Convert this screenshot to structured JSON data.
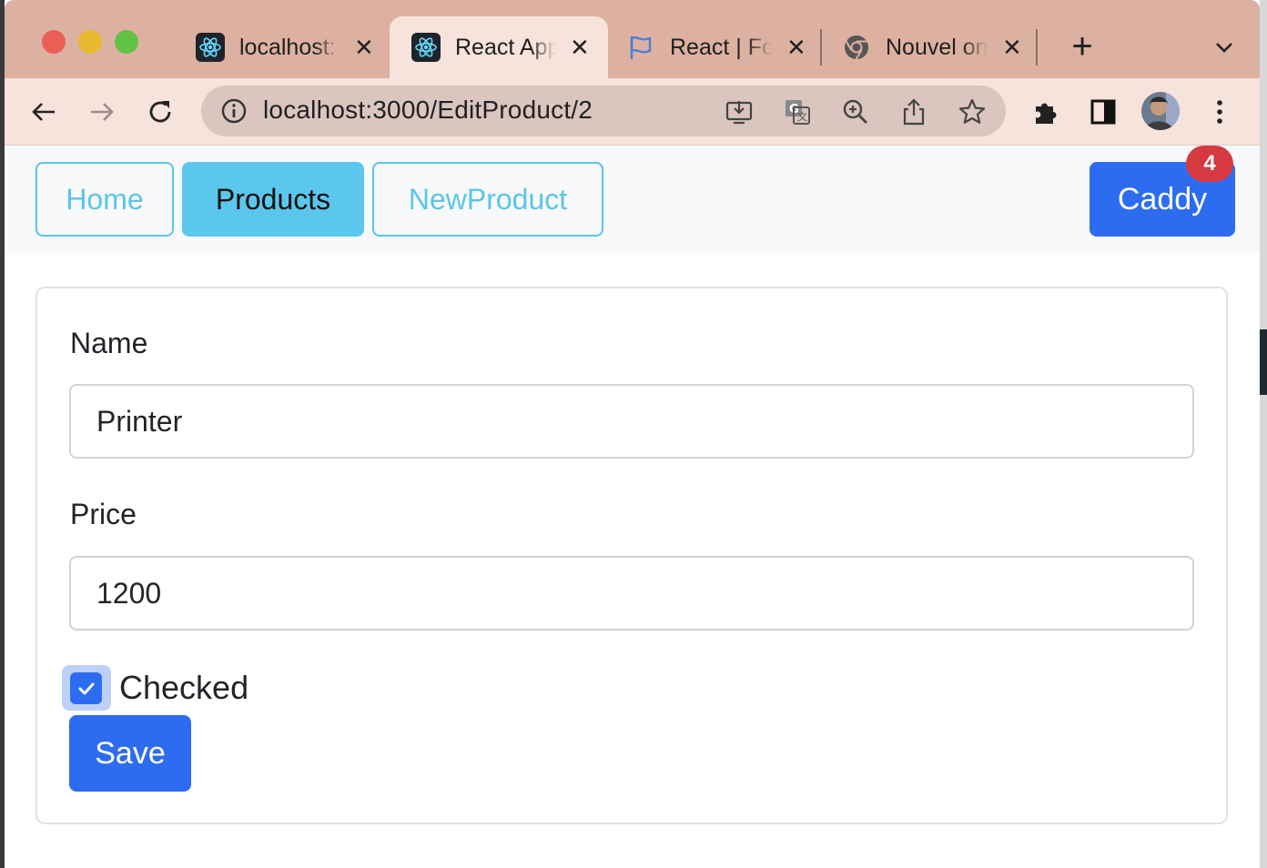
{
  "browser": {
    "tabs": [
      {
        "label": "localhost:",
        "icon": "react-icon",
        "active": false
      },
      {
        "label": "React App",
        "icon": "react-icon",
        "active": true
      },
      {
        "label": "React | Fo",
        "icon": "flag-icon",
        "active": false
      },
      {
        "label": "Nouvel on",
        "icon": "chrome-icon",
        "active": false
      }
    ],
    "new_tab_label": "+",
    "url": "localhost:3000/EditProduct/2"
  },
  "nav": {
    "home_label": "Home",
    "products_label": "Products",
    "newproduct_label": "NewProduct",
    "caddy_label": "Caddy",
    "caddy_count": "4"
  },
  "form": {
    "name_label": "Name",
    "name_value": "Printer",
    "price_label": "Price",
    "price_value": "1200",
    "checked_label": "Checked",
    "checked": true,
    "save_label": "Save"
  },
  "colors": {
    "accent": "#2d6cf0",
    "info": "#5bc7ec",
    "badge": "#d6393f",
    "tabstrip": "#ddb1a1"
  }
}
